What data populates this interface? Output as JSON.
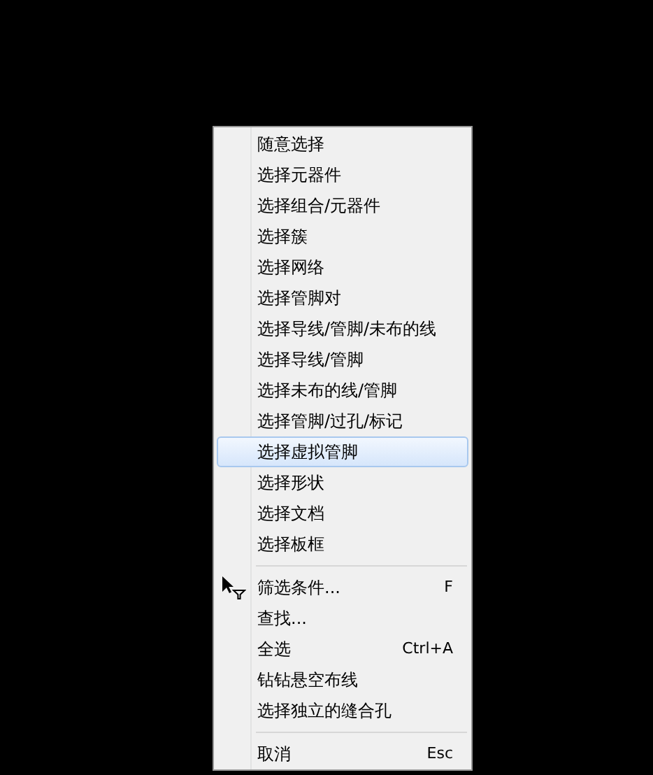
{
  "context_menu": {
    "sections": [
      {
        "items": [
          {
            "label": "随意选择",
            "selected": false
          },
          {
            "label": "选择元器件",
            "selected": false
          },
          {
            "label": "选择组合/元器件",
            "selected": false
          },
          {
            "label": "选择簇",
            "selected": false
          },
          {
            "label": "选择网络",
            "selected": false
          },
          {
            "label": "选择管脚对",
            "selected": false
          },
          {
            "label": "选择导线/管脚/未布的线",
            "selected": false
          },
          {
            "label": "选择导线/管脚",
            "selected": false
          },
          {
            "label": "选择未布的线/管脚",
            "selected": false
          },
          {
            "label": "选择管脚/过孔/标记",
            "selected": false
          },
          {
            "label": "选择虚拟管脚",
            "selected": true
          },
          {
            "label": "选择形状",
            "selected": false
          },
          {
            "label": "选择文档",
            "selected": false
          },
          {
            "label": "选择板框",
            "selected": false
          }
        ]
      },
      {
        "items": [
          {
            "label": "筛选条件...",
            "shortcut": "F",
            "selected": false,
            "kind": "filter"
          },
          {
            "label": "查找...",
            "selected": false
          },
          {
            "label": "全选",
            "shortcut": "Ctrl+A",
            "selected": false
          },
          {
            "label": "钻钻悬空布线",
            "selected": false
          },
          {
            "label": "选择独立的缝合孔",
            "selected": false
          }
        ]
      },
      {
        "items": [
          {
            "label": "取消",
            "shortcut": "Esc",
            "selected": false
          }
        ]
      }
    ]
  }
}
